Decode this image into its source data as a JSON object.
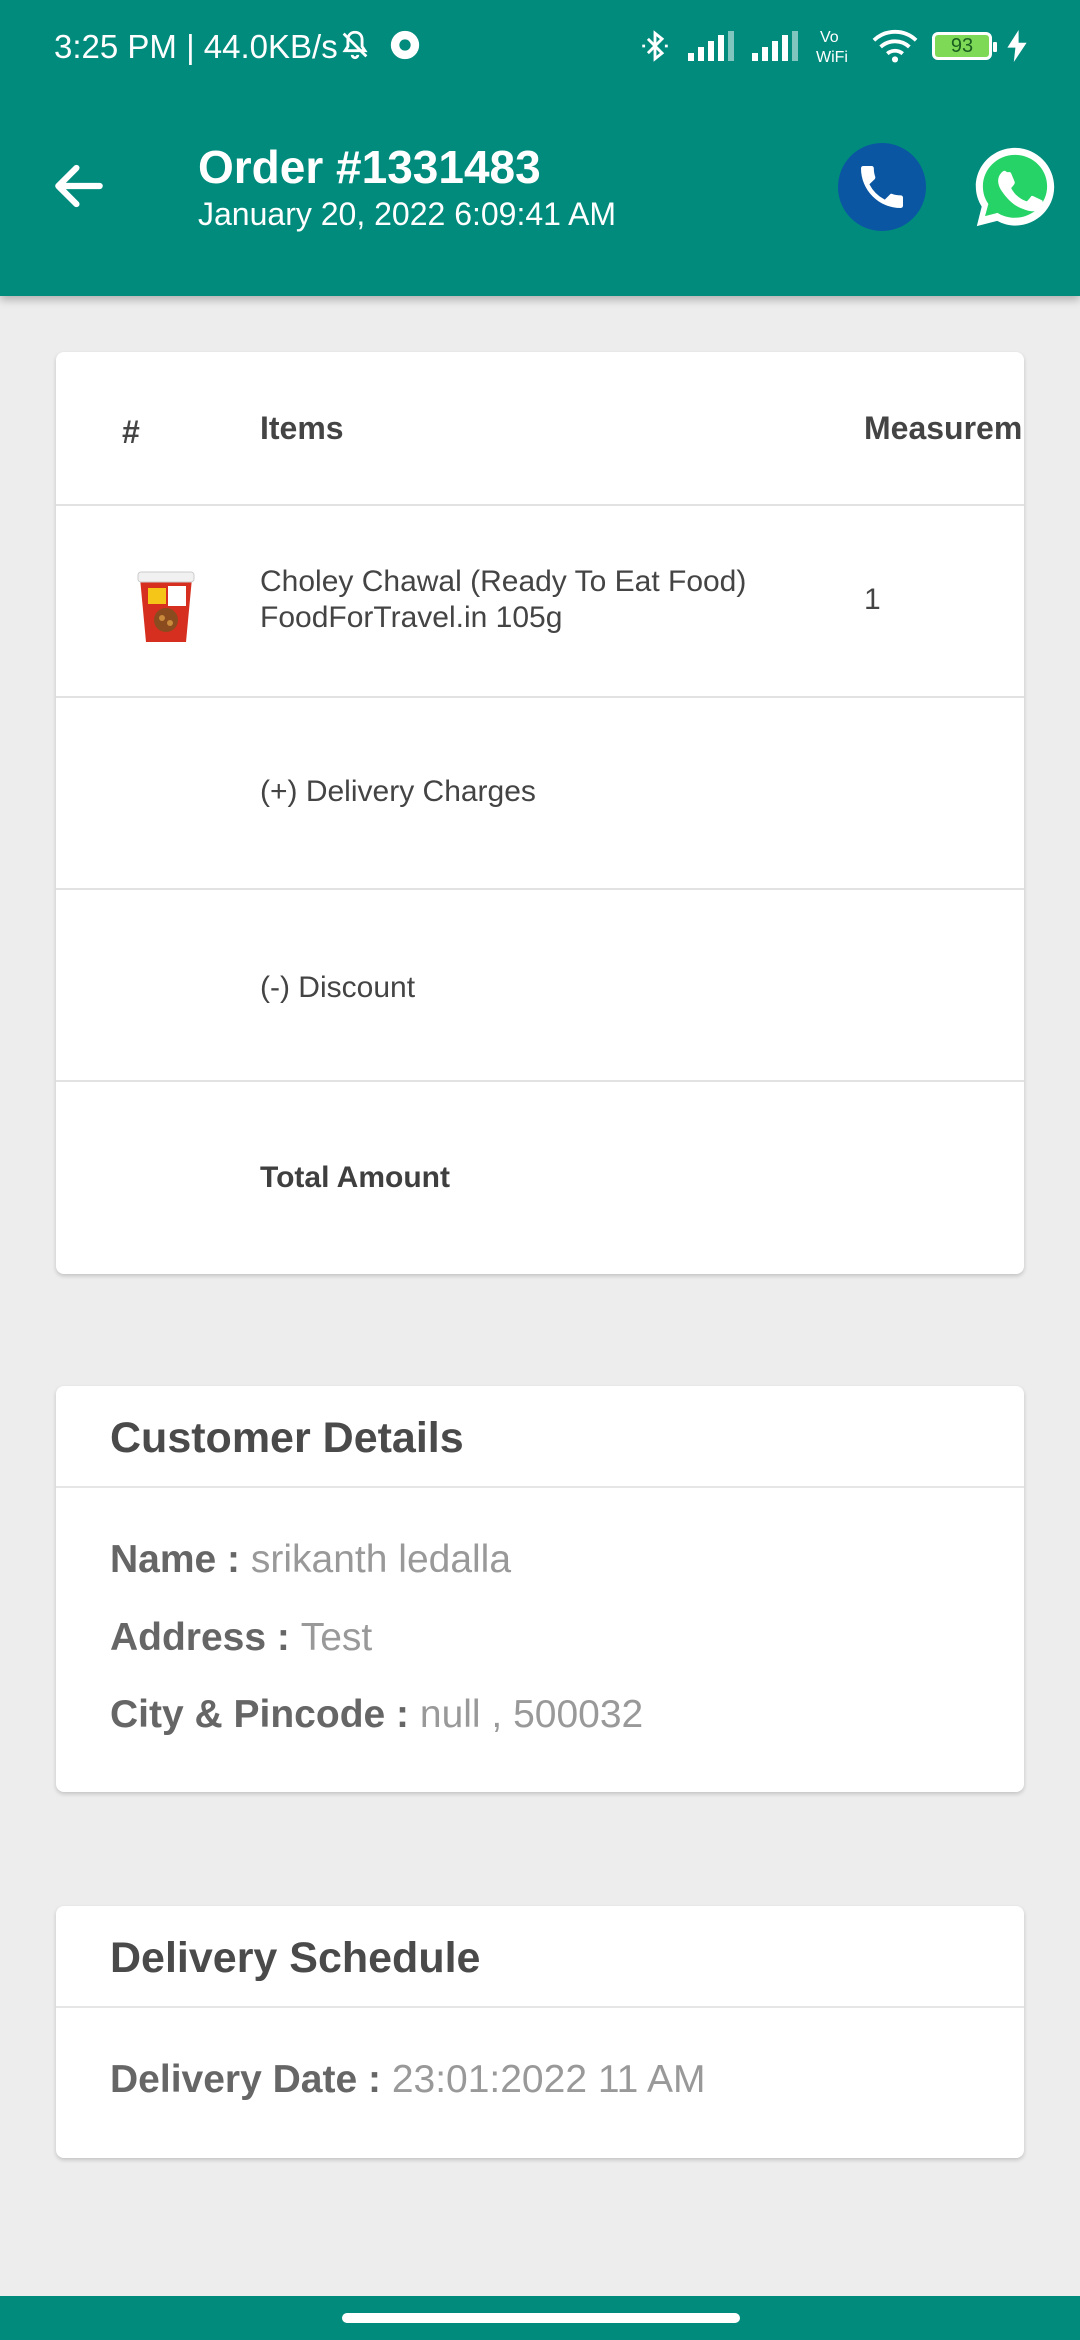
{
  "status_bar": {
    "time": "3:25 PM | 44.0KB/s",
    "battery": "93",
    "icons": [
      "mute-bell-icon",
      "app-icon",
      "bluetooth-icon",
      "signal-icon",
      "signal-icon",
      "vowifi-icon",
      "wifi-icon",
      "battery-icon",
      "charging-icon"
    ]
  },
  "header": {
    "title": "Order #1331483",
    "subtitle": "January 20, 2022 6:09:41 AM",
    "colors": {
      "appbar": "#008b7d",
      "call": "#0a56a3",
      "whatsapp": "#25d366"
    }
  },
  "items_table": {
    "columns": [
      "#",
      "Items",
      "Measurem"
    ],
    "rows": [
      {
        "name_line1": "Choley Chawal (Ready To Eat Food)",
        "name_line2": "FoodForTravel.in 105g",
        "measurement": "1"
      }
    ],
    "delivery_label": "(+) Delivery Charges",
    "discount_label": "(-) Discount",
    "total_label": "Total Amount"
  },
  "customer": {
    "title": "Customer Details",
    "name_label": "Name : ",
    "name_value": "srikanth ledalla",
    "address_label": "Address : ",
    "address_value": "Test",
    "city_label": "City & Pincode : ",
    "city_value": "null , 500032"
  },
  "schedule": {
    "title": "Delivery Schedule",
    "date_label": "Delivery Date : ",
    "date_value": "23:01:2022 11 AM"
  }
}
